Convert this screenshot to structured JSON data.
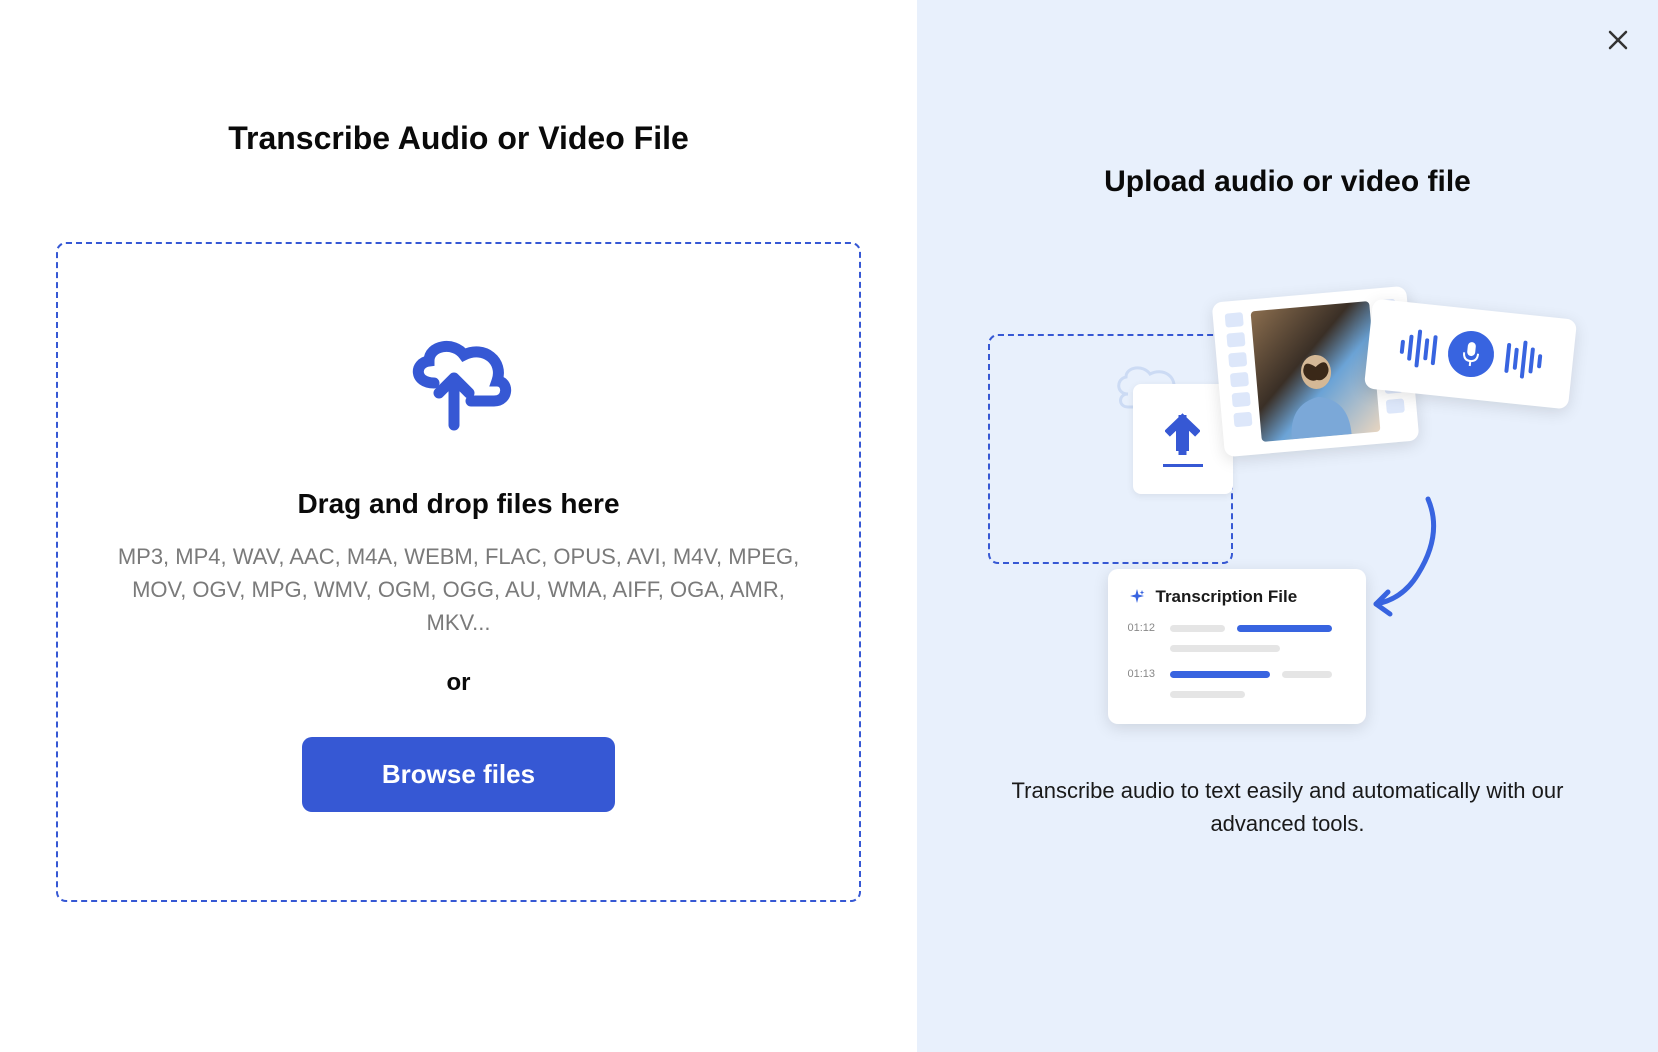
{
  "left": {
    "title": "Transcribe Audio or Video File",
    "drag_text": "Drag and drop files here",
    "formats": "MP3, MP4, WAV, AAC, M4A, WEBM, FLAC, OPUS, AVI, M4V, MPEG, MOV, OGV, MPG, WMV, OGM, OGG, AU, WMA, AIFF, OGA, AMR, MKV...",
    "or_text": "or",
    "browse_label": "Browse files"
  },
  "right": {
    "title": "Upload audio or video file",
    "description": "Transcribe audio to text easily and automatically with our advanced tools.",
    "transcription": {
      "title": "Transcription File",
      "time1": "01:12",
      "time2": "01:13"
    }
  },
  "colors": {
    "primary": "#3658d4",
    "accent": "#3864e0"
  }
}
